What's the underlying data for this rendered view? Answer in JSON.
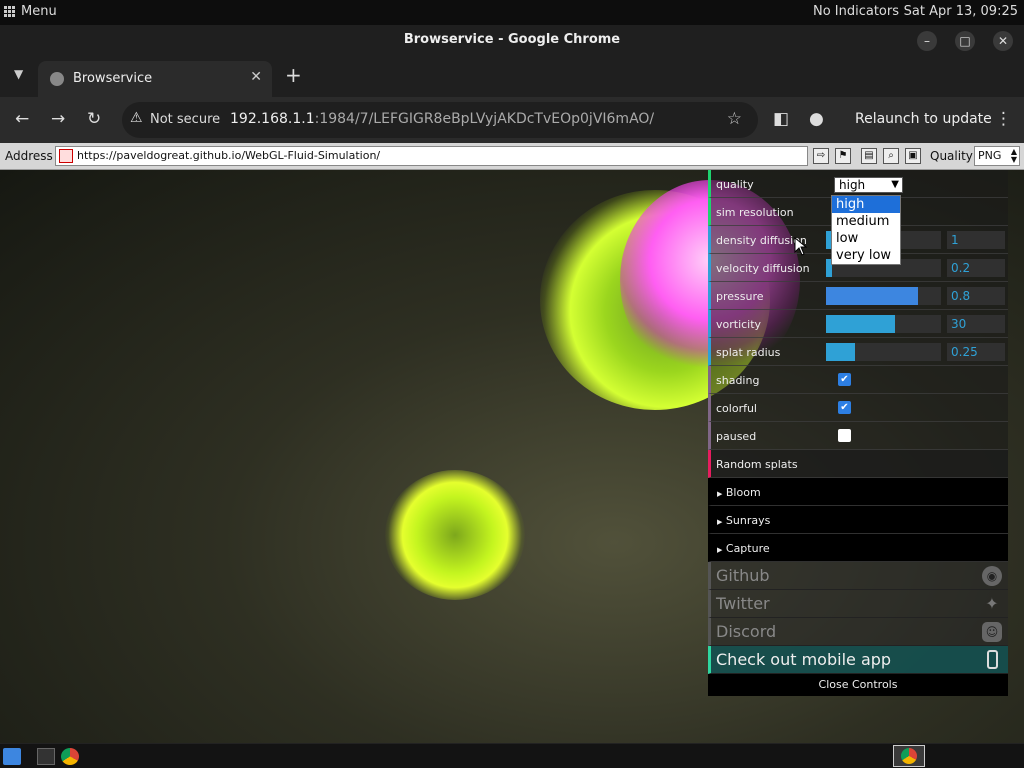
{
  "system": {
    "menu_label": "Menu",
    "indicators": "No Indicators",
    "clock": "Sat Apr 13, 09:25"
  },
  "window": {
    "title": "Browservice - Google Chrome"
  },
  "tabs": [
    {
      "title": "Browservice"
    }
  ],
  "omnibox": {
    "security": "Not secure",
    "host": "192.168.1.1",
    "path": ":1984/7/LEFGIGR8eBpLVyjAKDcTvEOp0jVI6mAO/",
    "relaunch": "Relaunch to update"
  },
  "browservice": {
    "address_label": "Address",
    "url": "https://paveldogreat.github.io/WebGL-Fluid-Simulation/",
    "quality_label": "Quality",
    "quality_value": "PNG"
  },
  "gui": {
    "quality": {
      "label": "quality",
      "value": "high",
      "options": [
        "high",
        "medium",
        "low",
        "very low"
      ]
    },
    "sim_resolution": {
      "label": "sim resolution"
    },
    "density_diffusion": {
      "label": "density diffusion",
      "value": "1",
      "fraction": 0.25
    },
    "velocity_diffusion": {
      "label": "velocity diffusion",
      "value": "0.2",
      "fraction": 0.05
    },
    "pressure": {
      "label": "pressure",
      "value": "0.8",
      "fraction": 0.8
    },
    "vorticity": {
      "label": "vorticity",
      "value": "30",
      "fraction": 0.6
    },
    "splat_radius": {
      "label": "splat radius",
      "value": "0.25",
      "fraction": 0.25
    },
    "shading": {
      "label": "shading",
      "checked": true
    },
    "colorful": {
      "label": "colorful",
      "checked": true
    },
    "paused": {
      "label": "paused",
      "checked": false
    },
    "random_splats": {
      "label": "Random splats"
    },
    "folders": [
      "Bloom",
      "Sunrays",
      "Capture"
    ],
    "links": [
      {
        "label": "Github",
        "icon": "github-icon"
      },
      {
        "label": "Twitter",
        "icon": "twitter-icon"
      },
      {
        "label": "Discord",
        "icon": "discord-icon"
      }
    ],
    "mobile_app": {
      "label": "Check out mobile app",
      "icon": "phone-icon"
    },
    "close_controls": "Close Controls"
  },
  "colors": {
    "accent": "#2fa1d6",
    "func": "#e61d5f",
    "blob_green": "#b8ff1a",
    "blob_pink": "#ff3cf0"
  }
}
